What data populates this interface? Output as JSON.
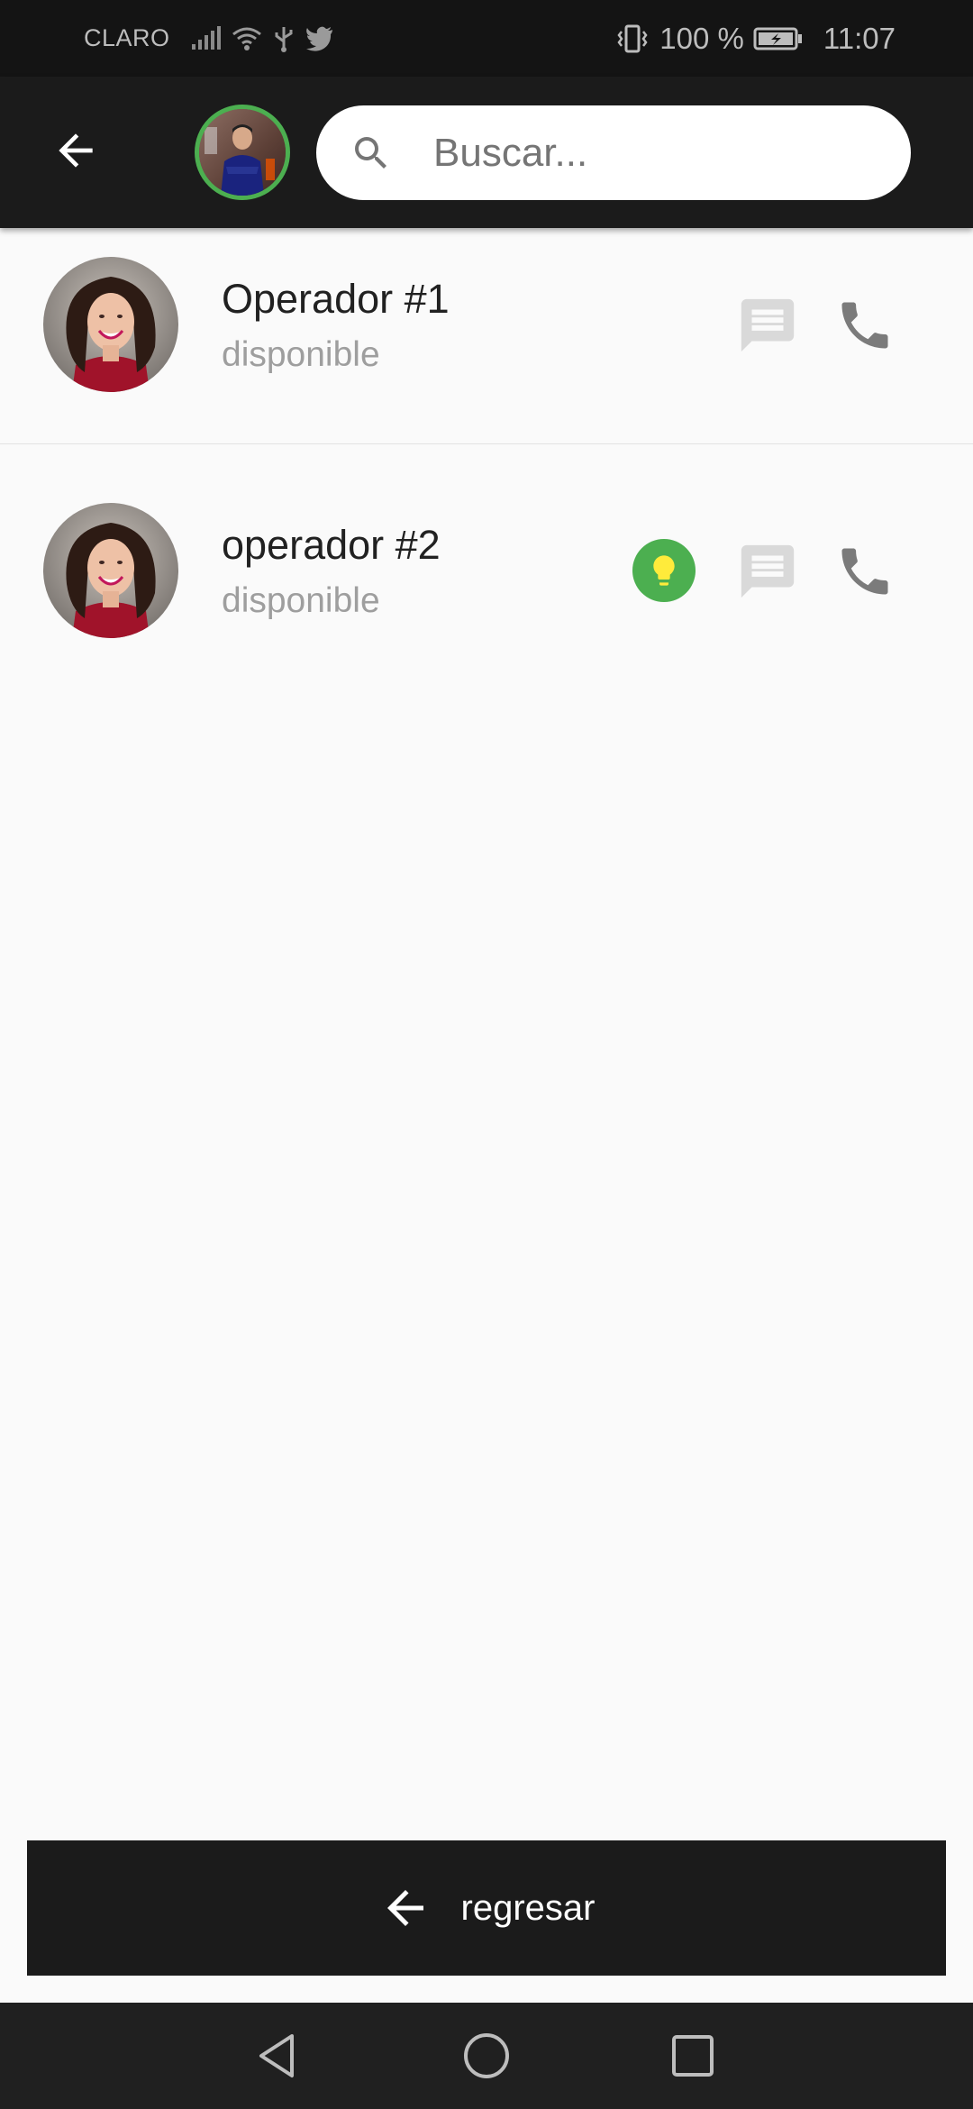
{
  "status_bar": {
    "carrier": "CLARO",
    "battery_percent": "100 %",
    "time": "11:07",
    "icons": [
      "signal-icon",
      "wifi-icon",
      "usb-icon",
      "twitter-icon",
      "vibrate-icon",
      "battery-charging-icon"
    ]
  },
  "app_bar": {
    "back_icon": "arrow-back-icon",
    "search": {
      "placeholder": "Buscar...",
      "value": ""
    }
  },
  "operators": [
    {
      "name": "Operador #1",
      "status": "disponible",
      "has_idea_badge": false
    },
    {
      "name": "operador #2",
      "status": "disponible",
      "has_idea_badge": true
    }
  ],
  "bottom_button": {
    "label": "regresar",
    "icon": "arrow-back-icon"
  },
  "nav_bar": {
    "icons": [
      "nav-back-icon",
      "nav-home-icon",
      "nav-recents-icon"
    ]
  },
  "colors": {
    "app_bar": "#1b1b1b",
    "status_bar": "#141414",
    "accent_green": "#4caf50",
    "bulb_yellow": "#ffeb3b",
    "icon_grey": "#7b7b7b",
    "chat_grey": "#d9d9d9"
  }
}
